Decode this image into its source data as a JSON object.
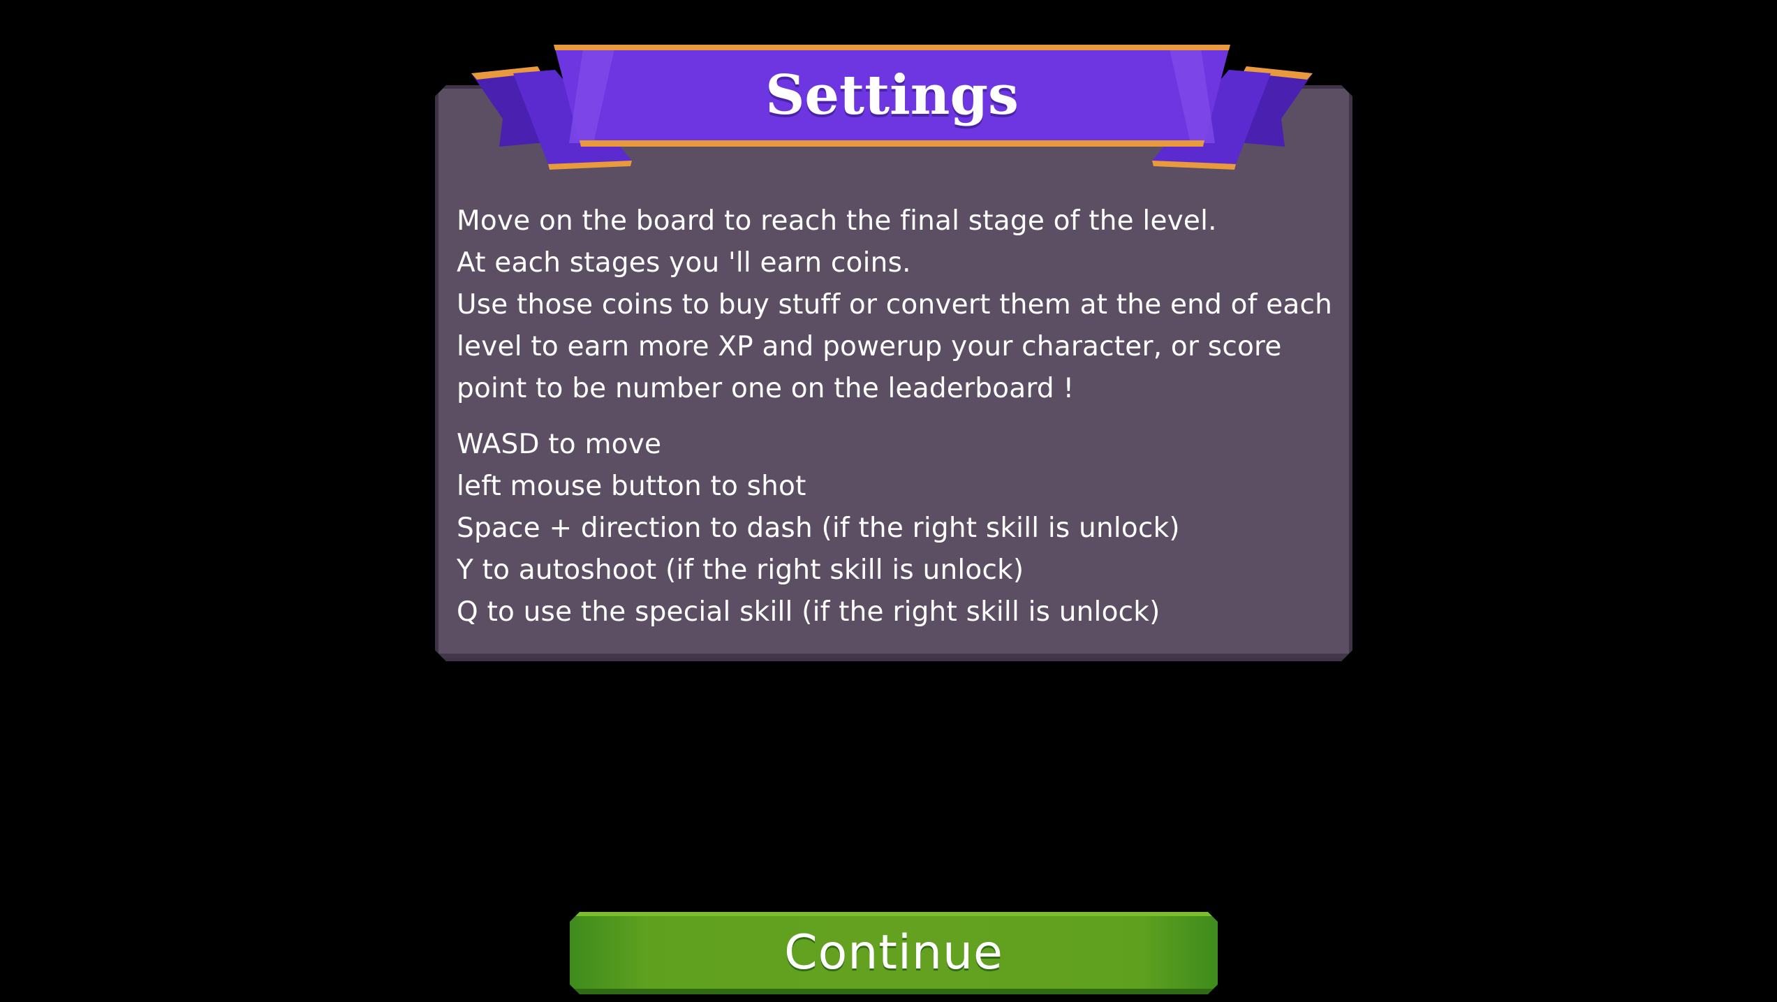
{
  "dialog": {
    "title": "Settings",
    "description_lines": [
      "Move on the board to reach the final stage of the level.",
      "At each stages you 'll earn coins.",
      "Use those coins to buy stuff or convert them at the end of each",
      "level to earn more XP and powerup your character, or score",
      "point to be number one on the leaderboard !"
    ],
    "controls_lines": [
      "WASD to move",
      "left mouse button to shot",
      "Space + direction to dash (if the right skill is unlock)",
      "Y to autoshoot (if the right skill is unlock)",
      "Q to use the special skill (if the right skill is unlock)"
    ]
  },
  "continue_button": {
    "label": "Continue"
  },
  "colors": {
    "background": "#000000",
    "panel": "#5c4e63",
    "panel_border": "#3f3347",
    "ribbon": "#6e36e0",
    "ribbon_trim": "#e89a3c",
    "button": "#62a120"
  }
}
